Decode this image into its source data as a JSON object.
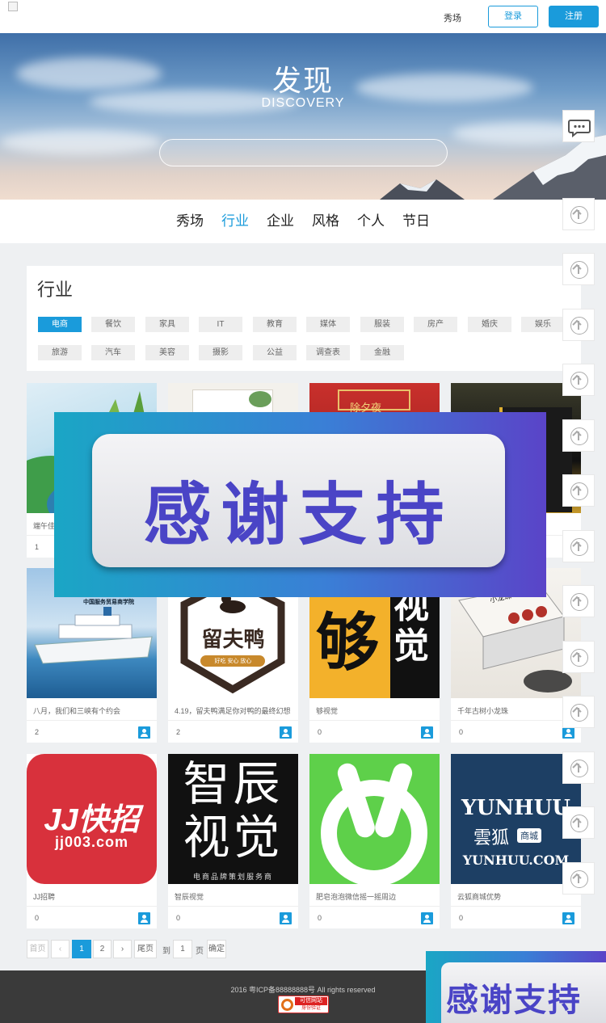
{
  "header": {
    "nav_xiuchang": "秀场",
    "login": "登录",
    "register": "注册"
  },
  "banner": {
    "title": "发现",
    "subtitle": "DISCOVERY",
    "search_placeholder": ""
  },
  "catnav": {
    "items": [
      "秀场",
      "行业",
      "企业",
      "风格",
      "个人",
      "节日"
    ],
    "active_index": 1
  },
  "panel": {
    "title": "行业",
    "tags_row1": [
      "电商",
      "餐饮",
      "家具",
      "IT",
      "教育",
      "媒体",
      "服装",
      "房产",
      "婚庆",
      "娱乐"
    ],
    "tags_row2": [
      "旅游",
      "汽车",
      "美容",
      "摄影",
      "公益",
      "调查表",
      "金融"
    ],
    "active_tag": "电商"
  },
  "cards": [
    {
      "name": "端午佳节",
      "count": "1"
    },
    {
      "name": "",
      "count": ""
    },
    {
      "name": "",
      "count": ""
    },
    {
      "name": "",
      "count": ""
    },
    {
      "name": "八月，我们和三峡有个约会",
      "count": "2"
    },
    {
      "name": "4.19，留夫鸭满足你对鸭的最终幻想",
      "count": "2"
    },
    {
      "name": "够视觉",
      "count": "0"
    },
    {
      "name": "千年古树小龙珠",
      "count": "0"
    },
    {
      "name": "JJ招聘",
      "count": "0"
    },
    {
      "name": "智辰视觉",
      "count": "0"
    },
    {
      "name": "肥皂泡泡微信摇一摇周边",
      "count": "0"
    },
    {
      "name": "云狐商城优势",
      "count": "0"
    }
  ],
  "card_images": {
    "ship_caption": "中国服务贸易商学院",
    "duck_text": "留夫鸭",
    "duck_sub": "好吃 安心 放心",
    "gou_text": "够",
    "shijue_text": "视觉",
    "jj_text": "JJ快招",
    "jj_url": "jj003.com",
    "zhichen_line1": "智辰",
    "zhichen_line2": "视觉",
    "zhichen_sub": "电商品牌策划服务商",
    "yunhuu_en": "YUNHUU",
    "yunhuu_cn": "雲狐",
    "yunhuu_tag": "商城",
    "yunhuu_url": "YUNHUU.COM",
    "chuxi_text": "除夕夜",
    "longzhu_text": "小龙珠"
  },
  "pagination": {
    "first": "首页",
    "prev": "‹",
    "pages": [
      "1",
      "2"
    ],
    "active_page": "1",
    "next": "›",
    "last": "尾页",
    "goto": "到",
    "page_input": "1",
    "page_unit": "页",
    "confirm": "确定"
  },
  "footer": {
    "copyright": "2016 粤ICP备88888888号 All rights reserved",
    "badge_top": "可信网站",
    "badge_bottom": "身份验证"
  },
  "overlay": {
    "text": "感谢支持"
  },
  "colors": {
    "accent": "#1a9bdb",
    "footer_bg": "#3a3a3a",
    "overlay_text": "#4a44c6"
  }
}
